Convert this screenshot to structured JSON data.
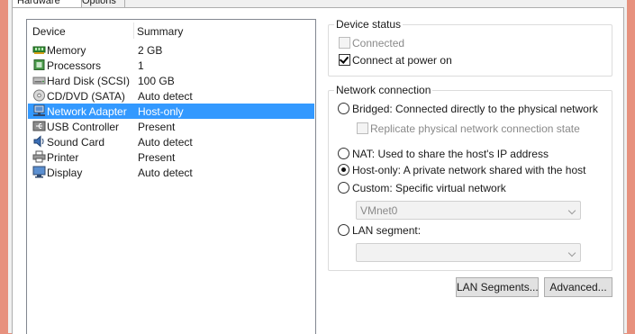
{
  "tabs": [
    {
      "label": "Hardware",
      "active": true
    },
    {
      "label": "Options",
      "active": false
    }
  ],
  "device_list": {
    "headers": {
      "device": "Device",
      "summary": "Summary"
    },
    "rows": [
      {
        "name": "Memory",
        "summary": "2 GB",
        "icon": "memory-icon"
      },
      {
        "name": "Processors",
        "summary": "1",
        "icon": "processor-icon"
      },
      {
        "name": "Hard Disk (SCSI)",
        "summary": "100 GB",
        "icon": "hard-disk-icon"
      },
      {
        "name": "CD/DVD (SATA)",
        "summary": "Auto detect",
        "icon": "cd-dvd-icon"
      },
      {
        "name": "Network Adapter",
        "summary": "Host-only",
        "icon": "network-adapter-icon",
        "selected": true
      },
      {
        "name": "USB Controller",
        "summary": "Present",
        "icon": "usb-icon"
      },
      {
        "name": "Sound Card",
        "summary": "Auto detect",
        "icon": "sound-card-icon"
      },
      {
        "name": "Printer",
        "summary": "Present",
        "icon": "printer-icon"
      },
      {
        "name": "Display",
        "summary": "Auto detect",
        "icon": "display-icon"
      }
    ]
  },
  "device_status": {
    "title": "Device status",
    "connected": {
      "label": "Connected",
      "checked": false,
      "disabled": true
    },
    "connect_at_power_on": {
      "label": "Connect at power on",
      "checked": true
    }
  },
  "network_connection": {
    "title": "Network connection",
    "bridged": {
      "label": "Bridged: Connected directly to the physical network",
      "selected": false
    },
    "replicate": {
      "label": "Replicate physical network connection state",
      "checked": false,
      "disabled": true
    },
    "nat": {
      "label": "NAT: Used to share the host's IP address",
      "selected": false
    },
    "host_only": {
      "label": "Host-only: A private network shared with the host",
      "selected": true
    },
    "custom": {
      "label": "Custom: Specific virtual network",
      "selected": false
    },
    "vmnet_select": {
      "value": "VMnet0"
    },
    "lan_segment": {
      "label": "LAN segment:",
      "selected": false
    },
    "lan_segment_select": {
      "value": ""
    }
  },
  "buttons": {
    "lan_segments": "LAN Segments...",
    "advanced": "Advanced..."
  },
  "colors": {
    "selection": "#3399ff",
    "background_strip": "#e7917e"
  }
}
